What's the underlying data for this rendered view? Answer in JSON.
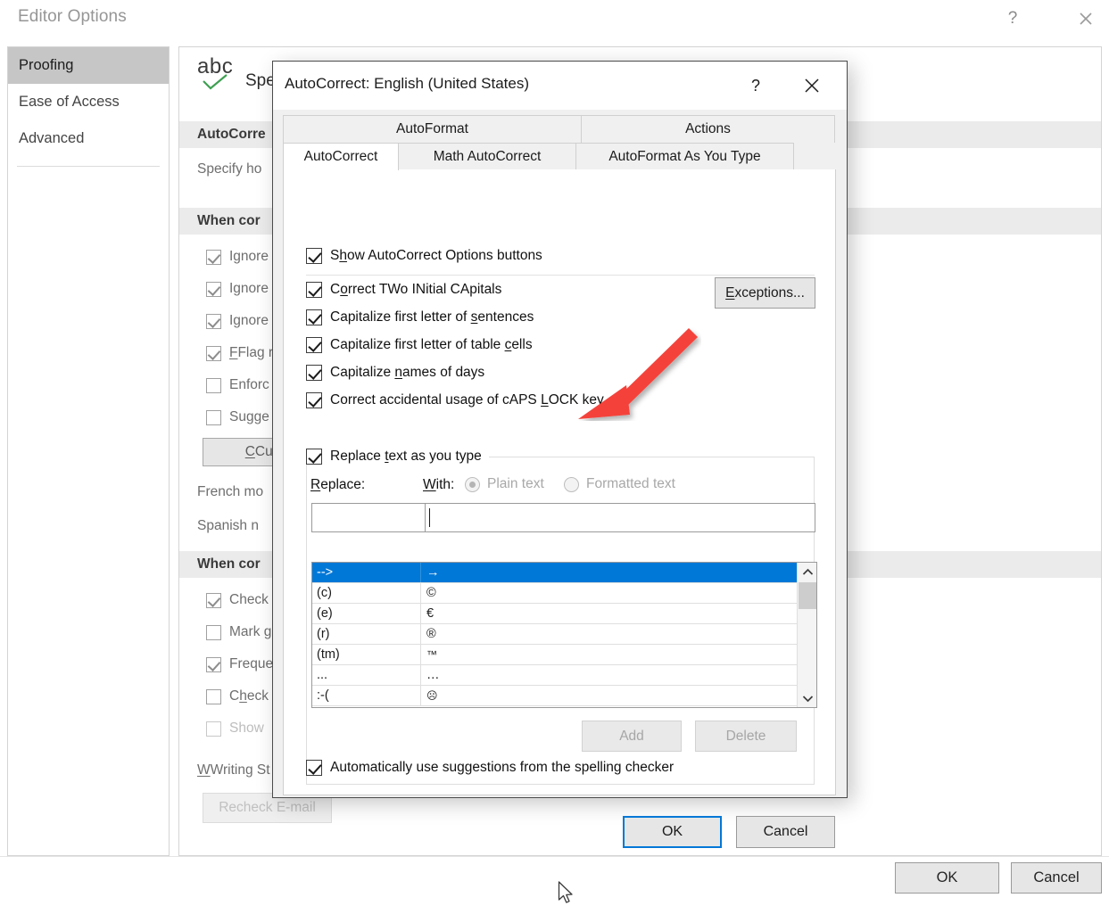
{
  "editor_options": {
    "title": "Editor Options",
    "help_icon": "?",
    "close_icon": "close-icon",
    "sidebar": {
      "items": [
        {
          "label": "Proofing",
          "selected": true
        },
        {
          "label": "Ease of Access",
          "selected": false
        },
        {
          "label": "Advanced",
          "selected": false
        }
      ]
    },
    "main": {
      "spelling_icon_caption": "Spe",
      "abc_icon_text": "abc",
      "band_autocorrect": "AutoCorre",
      "text_specify": "Specify ho",
      "band_when_correcting_1": "When cor",
      "band_when_correcting_2": "When cor",
      "checkboxes_group1": [
        {
          "label": "Ignore",
          "checked": true,
          "disabled": false
        },
        {
          "label": "Ignore",
          "checked": true,
          "disabled": false
        },
        {
          "label": "Ignore",
          "checked": true,
          "disabled": false
        },
        {
          "label": "Flag re",
          "checked": true,
          "disabled": false
        },
        {
          "label": "Enforc",
          "checked": false,
          "disabled": false
        },
        {
          "label": "Sugge",
          "checked": false,
          "disabled": false
        }
      ],
      "custom_button": "Custom",
      "french_label": "French mo",
      "spanish_label": "Spanish n",
      "checkboxes_group2": [
        {
          "label": "Check",
          "checked": true,
          "disabled": false
        },
        {
          "label": "Mark g",
          "checked": false,
          "disabled": false
        },
        {
          "label": "Freque",
          "checked": true,
          "disabled": false
        },
        {
          "label": "Check",
          "checked": false,
          "disabled": false
        },
        {
          "label": "Show",
          "checked": false,
          "disabled": true
        }
      ],
      "writing_style_label": "Writing St",
      "recheck_button": "Recheck E-mail"
    },
    "footer": {
      "ok": "OK",
      "cancel": "Cancel"
    }
  },
  "autocorrect_dialog": {
    "title": "AutoCorrect: English (United States)",
    "help_icon": "?",
    "close_icon": "close-icon",
    "tabs_row1": [
      {
        "label": "AutoFormat",
        "active": false
      },
      {
        "label": "Actions",
        "active": false
      }
    ],
    "tabs_row2": [
      {
        "label": "AutoCorrect",
        "active": true
      },
      {
        "label": "Math AutoCorrect",
        "active": false
      },
      {
        "label": "AutoFormat As You Type",
        "active": false
      }
    ],
    "options": {
      "show_buttons": {
        "label": "Show AutoCorrect Options buttons",
        "checked": true
      },
      "two_initial_caps": {
        "label": "Correct TWo INitial CApitals",
        "checked": true
      },
      "cap_sentences": {
        "label": "Capitalize first letter of sentences",
        "checked": true
      },
      "cap_table_cells": {
        "label": "Capitalize first letter of table cells",
        "checked": true
      },
      "cap_days": {
        "label": "Capitalize names of days",
        "checked": true
      },
      "caps_lock": {
        "label": "Correct accidental usage of cAPS LOCK key",
        "checked": true
      },
      "exceptions_button": "Exceptions..."
    },
    "replace_section": {
      "replace_as_you_type": {
        "label": "Replace text as you type",
        "checked": true
      },
      "replace_label": "Replace:",
      "with_label": "With:",
      "plain_text_radio": {
        "label": "Plain text",
        "selected": true,
        "disabled": true
      },
      "formatted_text_radio": {
        "label": "Formatted text",
        "selected": false,
        "disabled": true
      },
      "replace_input_value": "",
      "with_input_value": "",
      "columns": [
        "Replace",
        "With"
      ],
      "entries": [
        {
          "replace": "-->",
          "with": "→",
          "selected": true
        },
        {
          "replace": "(c)",
          "with": "©",
          "selected": false
        },
        {
          "replace": "(e)",
          "with": "€",
          "selected": false
        },
        {
          "replace": "(r)",
          "with": "®",
          "selected": false
        },
        {
          "replace": "(tm)",
          "with": "™",
          "selected": false
        },
        {
          "replace": "...",
          "with": "…",
          "selected": false
        },
        {
          "replace": ":-(",
          "with": "☹",
          "selected": false
        }
      ],
      "add_button": {
        "label": "Add",
        "disabled": true
      },
      "delete_button": {
        "label": "Delete",
        "disabled": true
      },
      "auto_suggestions": {
        "label": "Automatically use suggestions from the spelling checker",
        "checked": true
      }
    },
    "footer": {
      "ok": "OK",
      "cancel": "Cancel"
    }
  },
  "annotation": {
    "arrow_color": "#F4433A",
    "points_to": "formatted-text-radio"
  },
  "colors": {
    "selection_blue": "#0078D7",
    "sidebar_selected": "#C6C6C6",
    "band_gray": "#EBEBEB",
    "button_face": "#E6E6E6"
  }
}
